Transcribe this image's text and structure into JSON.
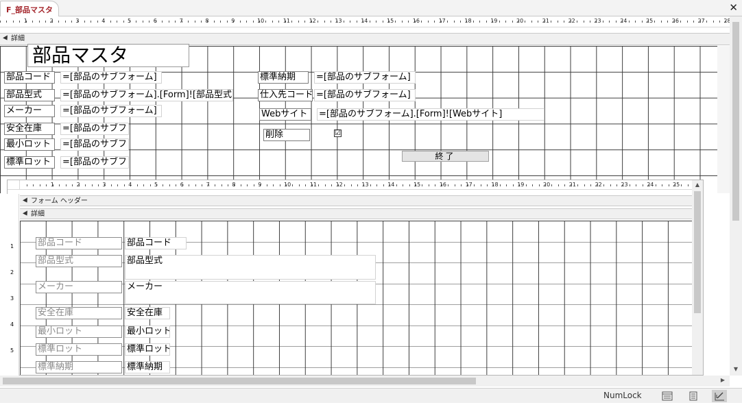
{
  "tab": {
    "title": "F_部品マスタ",
    "close_glyph": "✕"
  },
  "ruler": {
    "numbers": [
      "1",
      "2",
      "3",
      "4",
      "5",
      "6",
      "7",
      "8",
      "9",
      "10",
      "11",
      "12",
      "13",
      "14",
      "15",
      "16",
      "17",
      "18",
      "19",
      "20",
      "21",
      "22",
      "23",
      "24",
      "25",
      "26",
      "27",
      "28"
    ]
  },
  "main_section": {
    "label": "詳細"
  },
  "form": {
    "title": "部品マスタ",
    "fields_left": [
      {
        "label": "部品コード",
        "value": "=[部品のサブフォーム]"
      },
      {
        "label": "部品型式",
        "value": "=[部品のサブフォーム].[Form]![部品型式"
      },
      {
        "label": "メーカー",
        "value": "=[部品のサブフォーム]"
      },
      {
        "label": "安全在庫",
        "value": "=[部品のサブフ"
      },
      {
        "label": "最小ロット",
        "value": "=[部品のサブフ"
      },
      {
        "label": "標準ロット",
        "value": "=[部品のサブフ"
      }
    ],
    "fields_right": [
      {
        "label": "標準納期",
        "value": "=[部品のサブフォーム]"
      },
      {
        "label": "仕入先コード",
        "value": "=[部品のサブフォーム]"
      },
      {
        "label": "Webサイト",
        "value": "=[部品のサブフォーム].[Form]![Webサイト]"
      }
    ],
    "delete_label": "削除",
    "delete_checked": "☑",
    "exit_button": "終了"
  },
  "subform": {
    "ruler_numbers": [
      "1",
      "2",
      "3",
      "4",
      "5",
      "6",
      "7",
      "8",
      "9",
      "10",
      "11",
      "12",
      "13",
      "14",
      "15",
      "16",
      "17",
      "18",
      "19",
      "20",
      "21",
      "22",
      "23",
      "24",
      "25"
    ],
    "vruler_numbers": [
      "1",
      "2",
      "3",
      "4",
      "5"
    ],
    "header_section": "フォーム ヘッダー",
    "detail_section": "詳細",
    "rows": [
      {
        "label": "部品コード",
        "field": "部品コード"
      },
      {
        "label": "部品型式",
        "field": "部品型式"
      },
      {
        "label": "メーカー",
        "field": "メーカー"
      },
      {
        "label": "安全在庫",
        "field": "安全在庫"
      },
      {
        "label": "最小ロット",
        "field": "最小ロット"
      },
      {
        "label": "標準ロット",
        "field": "標準ロット"
      },
      {
        "label": "標準納期",
        "field": "標準納期"
      }
    ]
  },
  "statusbar": {
    "numlock": "NumLock"
  },
  "icons": {
    "up": "▲",
    "down": "▼",
    "right": "▶"
  }
}
